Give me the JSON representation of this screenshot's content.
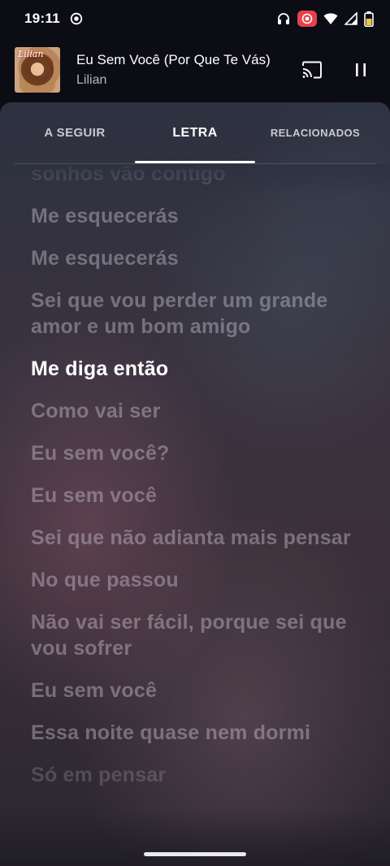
{
  "status_bar": {
    "time": "19:11",
    "icons": [
      "record-icon",
      "headphones-icon",
      "screen-record-icon",
      "wifi-icon",
      "signal-icon",
      "battery-icon"
    ]
  },
  "mini_player": {
    "title": "Eu Sem Você (Por Que Te Vás)",
    "artist": "Lilian",
    "album_art_text": "Lilian",
    "controls": [
      "cast-icon",
      "pause-icon"
    ]
  },
  "tabs": [
    {
      "label": "A SEGUIR",
      "active": false
    },
    {
      "label": "LETRA",
      "active": true
    },
    {
      "label": "RELACIONADOS",
      "active": false
    }
  ],
  "lyrics": [
    "sonhos vão contigo",
    "Me esquecerás",
    "Me esquecerás",
    "Sei que vou perder um grande amor e um bom amigo",
    "Me diga então",
    "Como vai ser",
    "Eu sem você?",
    "Eu sem você",
    "Sei que não adianta mais pensar",
    "No que passou",
    "Não vai ser fácil, porque sei que vou sofrer",
    "Eu sem você",
    "Essa noite quase nem dormi",
    "Só em pensar"
  ],
  "current_lyric_index": 4,
  "colors": {
    "accent": "#ffffff",
    "inactive_lyric": "#cdc8d4",
    "background": "#0c0d14",
    "record_badge": "#e8414b"
  }
}
